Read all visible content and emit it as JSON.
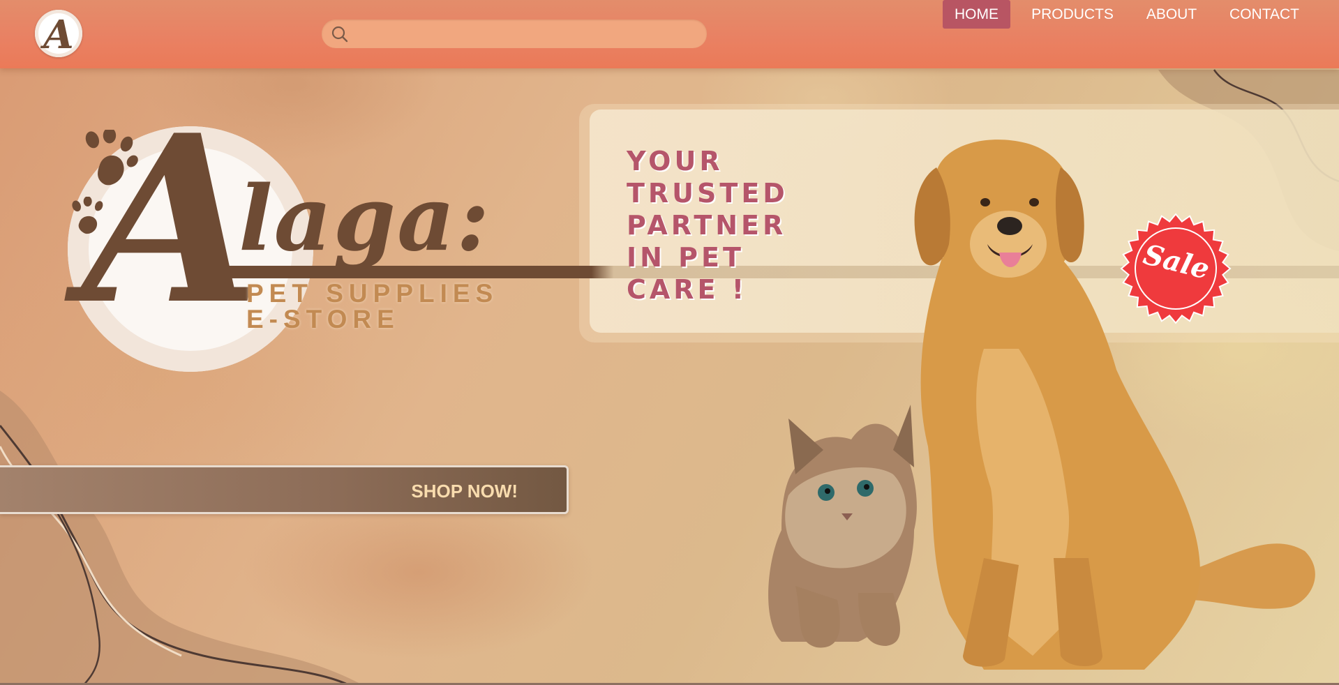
{
  "header": {
    "logo_letter": "A",
    "search": {
      "placeholder": "",
      "value": "",
      "icon": "search-icon"
    },
    "nav": [
      {
        "label": "HOME",
        "active": true
      },
      {
        "label": "PRODUCTS",
        "active": false
      },
      {
        "label": "ABOUT",
        "active": false
      },
      {
        "label": "CONTACT",
        "active": false
      }
    ]
  },
  "hero": {
    "brand_letter": "A",
    "brand_rest": "laga:",
    "tagline_line1": "PET SUPPLIES",
    "tagline_line2": "E-STORE",
    "headline": [
      "YOUR",
      "TRUSTED",
      "PARTNER",
      "IN PET",
      "CARE !"
    ],
    "sale_badge": "Sale",
    "cta": "SHOP NOW!"
  },
  "colors": {
    "header": "#eb7a58",
    "nav_active": "#b85563",
    "brand_brown": "#6e4b34",
    "tagline": "#c28a52",
    "headline": "#b5556a",
    "sale_red": "#ef3a3d",
    "cta_text": "#f9dcae"
  }
}
